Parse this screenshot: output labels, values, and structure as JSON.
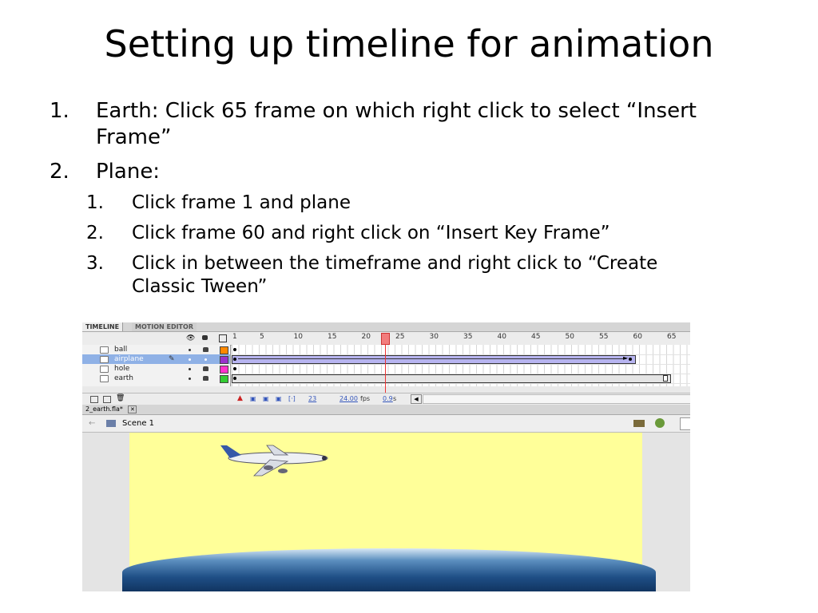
{
  "slide": {
    "title": "Setting up timeline for animation",
    "items": [
      {
        "num": "1.",
        "text": "Earth: Click 65 frame on which right click to select “Insert",
        "text2": "Frame”"
      },
      {
        "num": "2.",
        "text": "Plane:"
      }
    ],
    "subitems": [
      {
        "num": "1.",
        "text": "Click frame 1 and plane"
      },
      {
        "num": "2.",
        "text": "Click frame 60 and right click on “Insert Key Frame”"
      },
      {
        "num": "3.",
        "text": "Click in between the timeframe and right click to “Create",
        "text2": "Classic Tween”"
      }
    ]
  },
  "app": {
    "tabs": [
      "TIMELINE",
      "MOTION EDITOR"
    ],
    "ruler": [
      "1",
      "5",
      "10",
      "15",
      "20",
      "25",
      "30",
      "35",
      "40",
      "45",
      "50",
      "55",
      "60",
      "65"
    ],
    "layers": [
      {
        "name": "ball",
        "color": "#ff8800"
      },
      {
        "name": "airplane",
        "color": "#9933cc"
      },
      {
        "name": "hole",
        "color": "#ff33cc"
      },
      {
        "name": "earth",
        "color": "#33cc33"
      }
    ],
    "current_frame": "23",
    "fps": "24.00",
    "fps_label": "fps",
    "time": "0.9",
    "time_label": "s",
    "doc_tab": "2_earth.fla*",
    "scene": "Scene 1"
  }
}
